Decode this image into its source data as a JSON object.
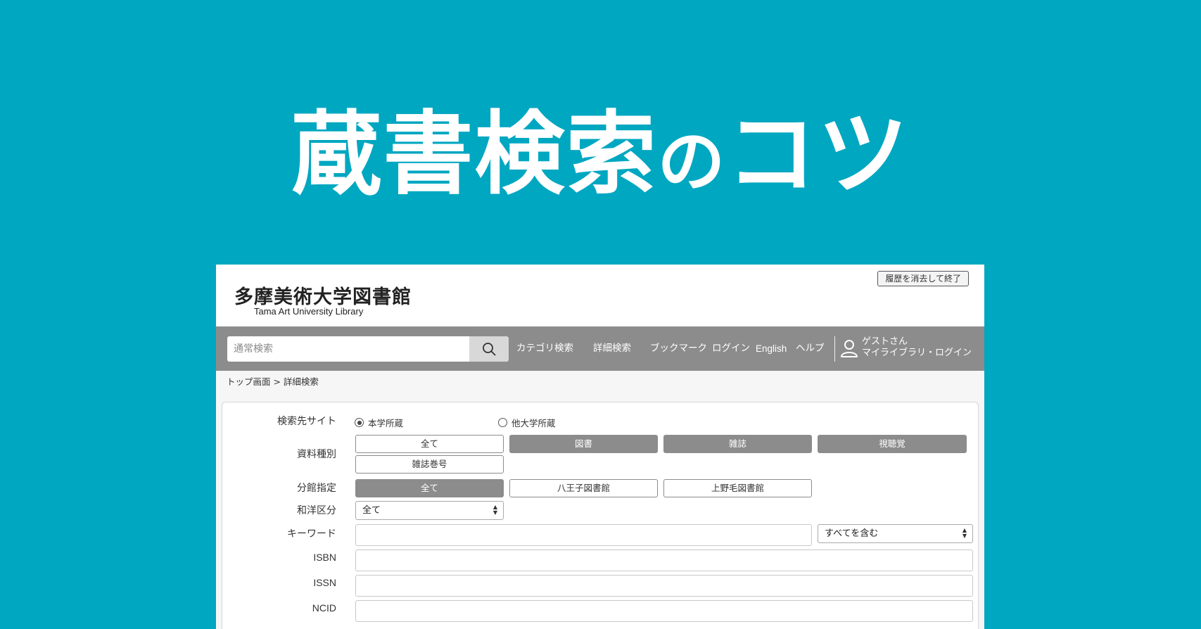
{
  "hero": {
    "title_main": "蔵書検索",
    "title_small": "の",
    "title_end": "コツ"
  },
  "header": {
    "logo_jp": "多摩美術大学図書館",
    "logo_en": "Tama Art University Library",
    "logout_label": "履歴を消去して終了"
  },
  "navbar": {
    "search_placeholder": "通常検索",
    "links": [
      "カテゴリ検索",
      "詳細検索",
      "ブックマーク",
      "ログイン",
      "English",
      "ヘルプ"
    ],
    "user_line1": "ゲストさん",
    "user_line2": "マイライブラリ・ログイン"
  },
  "breadcrumb": "トップ画面 > 詳細検索",
  "form": {
    "search_site": {
      "label": "検索先サイト",
      "options": [
        {
          "label": "本学所蔵",
          "selected": true
        },
        {
          "label": "他大学所蔵",
          "selected": false
        }
      ]
    },
    "material_type": {
      "label": "資料種別",
      "options": [
        {
          "label": "全て",
          "selected": false
        },
        {
          "label": "図書",
          "selected": true
        },
        {
          "label": "雑誌",
          "selected": true
        },
        {
          "label": "視聴覚",
          "selected": true
        },
        {
          "label": "雑誌巻号",
          "selected": false
        }
      ]
    },
    "branch": {
      "label": "分館指定",
      "options": [
        {
          "label": "全て",
          "selected": true
        },
        {
          "label": "八王子図書館",
          "selected": false
        },
        {
          "label": "上野毛図書館",
          "selected": false
        }
      ]
    },
    "language": {
      "label": "和洋区分",
      "value": "全て"
    },
    "keyword": {
      "label": "キーワード",
      "mode": "すべてを含む"
    },
    "isbn": {
      "label": "ISBN"
    },
    "issn": {
      "label": "ISSN"
    },
    "ncid": {
      "label": "NCID"
    }
  },
  "colors": {
    "background": "#00a7c1",
    "navbar": "#8c8c8c",
    "chip_active": "#8c8c8c"
  }
}
